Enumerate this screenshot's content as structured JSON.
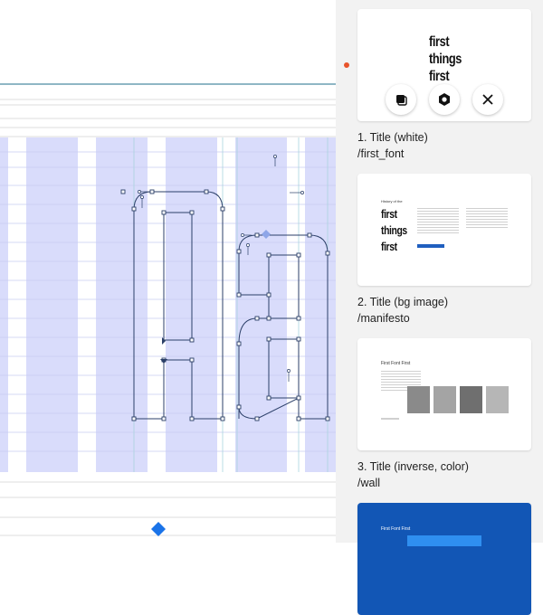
{
  "canvas": {
    "guide_color": "#1f6f8b",
    "column_fill": "#d9dcfb",
    "line_color": "#dcdcdc",
    "glyph_stroke": "#2b3f68",
    "handle_color": "#3d6fd6",
    "selection_handle_color": "#1a73e8"
  },
  "sidebar": {
    "marker_color": "#e8542c",
    "slides": [
      {
        "label": "1. Title (white)",
        "path": "/first_font",
        "preview_text": [
          "first",
          "things",
          "first"
        ],
        "actions": [
          {
            "name": "duplicate-icon"
          },
          {
            "name": "settings-icon"
          },
          {
            "name": "close-icon"
          }
        ]
      },
      {
        "label": "2. Title (bg image)",
        "path": "/manifesto",
        "preview_heading": "History of the",
        "preview_text": [
          "first",
          "things",
          "first"
        ],
        "preview_button_color": "#1f5fbf"
      },
      {
        "label": "3. Title (inverse, color)",
        "path": "/wall",
        "preview_heading": "First Font First"
      },
      {
        "label": "",
        "path": "",
        "preview_heading": "First Font First",
        "background": "#1256b5",
        "button_color": "#2f8ff0"
      }
    ]
  }
}
